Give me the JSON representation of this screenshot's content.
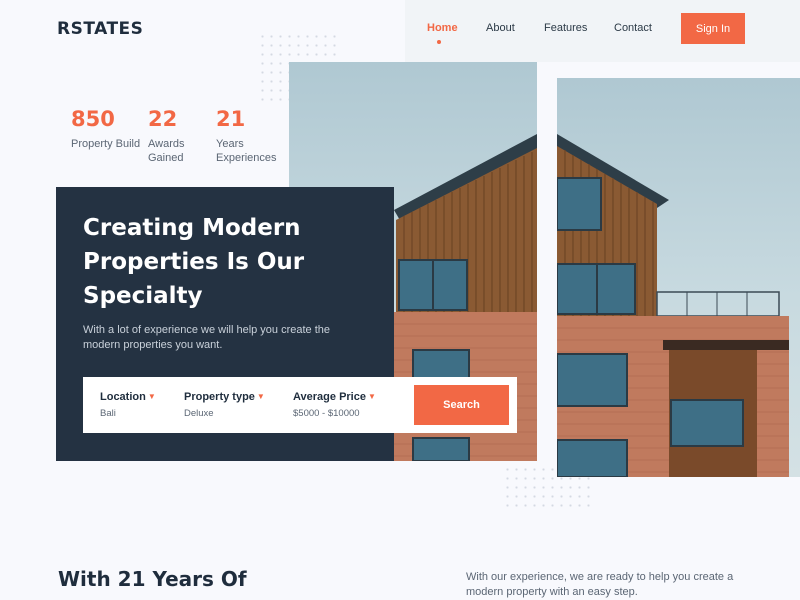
{
  "brand": {
    "logo": "RSTATES"
  },
  "nav": {
    "links": [
      {
        "label": "Home",
        "active": true
      },
      {
        "label": "About",
        "active": false
      },
      {
        "label": "Features",
        "active": false
      },
      {
        "label": "Contact",
        "active": false
      }
    ],
    "sign_in": "Sign In"
  },
  "stats": [
    {
      "value": "850",
      "label": "Property Build"
    },
    {
      "value": "22",
      "label": "Awards Gained"
    },
    {
      "value": "21",
      "label": "Years Experiences"
    }
  ],
  "hero": {
    "title": "Creating Modern Properties Is Our Specialty",
    "subtitle": "With a lot of experience we will help you create the modern properties you want."
  },
  "search": {
    "fields": [
      {
        "label": "Location",
        "value": "Bali",
        "icon": "chevron-down-icon"
      },
      {
        "label": "Property type",
        "value": "Deluxe",
        "icon": "chevron-down-icon"
      },
      {
        "label": "Average Price",
        "value": "$5000 - $10000",
        "icon": "chevron-down-icon"
      }
    ],
    "button": "Search"
  },
  "about": {
    "heading": "With 21 Years Of",
    "text": "With our experience, we are ready to help you create a modern property with an easy step."
  },
  "colors": {
    "accent": "#F26845",
    "dark": "#243242",
    "background": "#F8F9FD"
  }
}
